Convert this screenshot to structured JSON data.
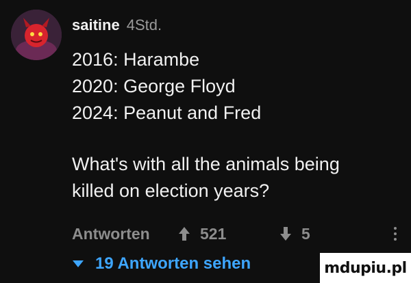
{
  "comment": {
    "author": "saitine",
    "timestamp": "4Std.",
    "lines": [
      "2016: Harambe",
      "2020: George Floyd",
      "2024: Peanut and Fred",
      "",
      "What's with all the animals being",
      "killed on election years?"
    ]
  },
  "actions": {
    "reply_label": "Antworten",
    "likes": "521",
    "dislikes": "5"
  },
  "replies_toggle": {
    "label": "19 Antworten sehen"
  },
  "watermark": {
    "text": "mdupiu.pl"
  },
  "colors": {
    "background": "#0f0f0f",
    "text": "#f1f1f1",
    "muted": "#8d8d8d",
    "link": "#3ea6ff"
  }
}
